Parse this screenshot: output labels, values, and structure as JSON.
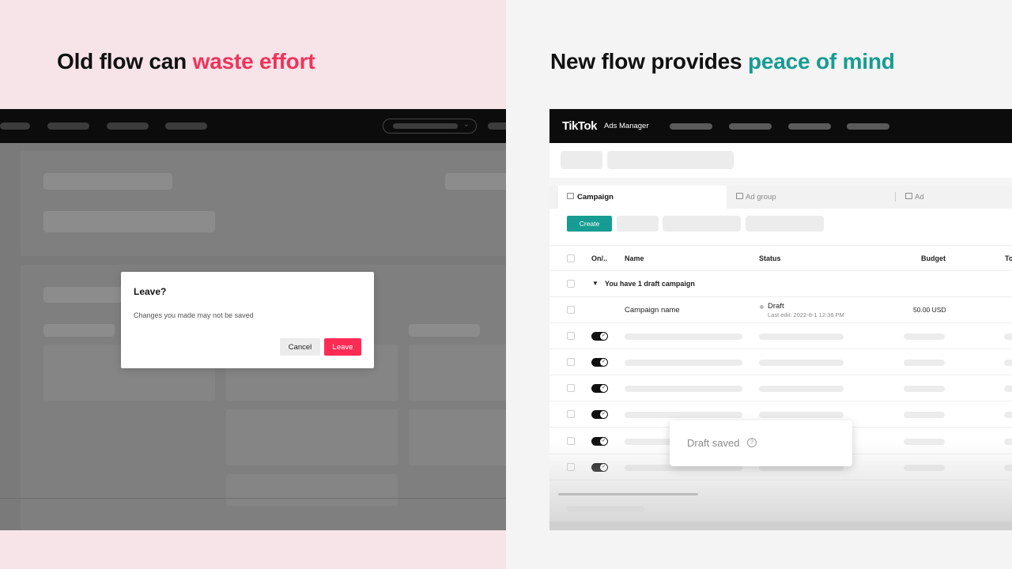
{
  "left": {
    "headline_prefix": "Old flow can ",
    "headline_accent": "waste effort",
    "dialog": {
      "title": "Leave?",
      "message": "Changes you made may not be saved",
      "cancel_label": "Cancel",
      "leave_label": "Leave"
    }
  },
  "right": {
    "headline_prefix": "New flow provides ",
    "headline_accent": "peace of mind",
    "app": {
      "brand": "TikTok",
      "brand_sub": "Ads Manager"
    },
    "tabs": [
      {
        "label": "Campaign"
      },
      {
        "label": "Ad group"
      },
      {
        "label": "Ad"
      }
    ],
    "create_label": "Create",
    "columns": {
      "onoff": "On/..",
      "name": "Name",
      "status": "Status",
      "budget": "Budget",
      "total": "To"
    },
    "draft_group": "You have 1 draft campaign",
    "draft_row": {
      "name": "Campaign name",
      "status": "Draft",
      "last_edit": "Last edit: 2022-8-1 12:38 PM",
      "budget": "50.00 USD"
    },
    "toast": {
      "text": "Draft saved",
      "icon": "question-circle-icon"
    }
  },
  "colors": {
    "accent_pink": "#f0335b",
    "accent_teal": "#169c93",
    "leave_button": "#fe2c55"
  }
}
